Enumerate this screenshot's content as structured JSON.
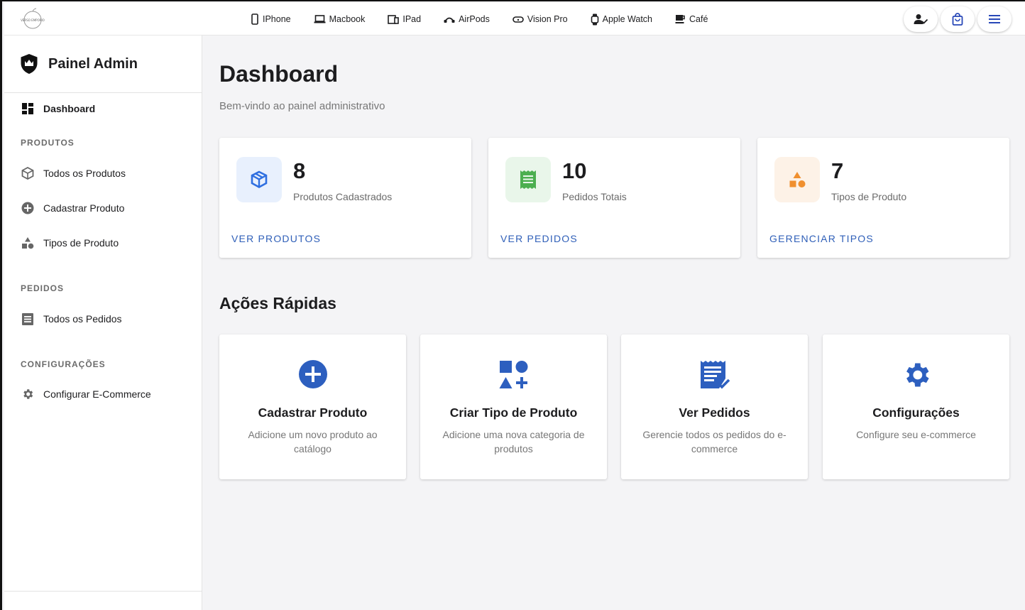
{
  "brand": {
    "logo_text": "VERSO EMPORIO"
  },
  "nav": {
    "items": [
      {
        "label": "IPhone",
        "icon": "phone-icon"
      },
      {
        "label": "Macbook",
        "icon": "laptop-icon"
      },
      {
        "label": "IPad",
        "icon": "tablet-icon"
      },
      {
        "label": "AirPods",
        "icon": "headphones-icon"
      },
      {
        "label": "Vision Pro",
        "icon": "vr-headset-icon"
      },
      {
        "label": "Apple Watch",
        "icon": "watch-icon"
      },
      {
        "label": "Café",
        "icon": "coffee-icon"
      }
    ],
    "actions": [
      "user-check-icon",
      "shopping-bag-icon",
      "menu-icon"
    ]
  },
  "sidebar": {
    "title": "Painel Admin",
    "dashboard_label": "Dashboard",
    "sections": {
      "produtos": "PRODUTOS",
      "pedidos": "PEDIDOS",
      "config": "CONFIGURAÇÕES"
    },
    "items": {
      "todos_produtos": "Todos os Produtos",
      "cadastrar_produto": "Cadastrar Produto",
      "tipos_produto": "Tipos de Produto",
      "todos_pedidos": "Todos os Pedidos",
      "configurar": "Configurar E-Commerce"
    }
  },
  "main": {
    "title": "Dashboard",
    "subtitle": "Bem-vindo ao painel administrativo",
    "stats": [
      {
        "value": "8",
        "label": "Produtos Cadastrados",
        "link": "VER PRODUTOS",
        "color": "#2f6fe0"
      },
      {
        "value": "10",
        "label": "Pedidos Totais",
        "link": "VER PEDIDOS",
        "color": "#4caf50"
      },
      {
        "value": "7",
        "label": "Tipos de Produto",
        "link": "GERENCIAR TIPOS",
        "color": "#f0902f"
      }
    ],
    "quick_title": "Ações Rápidas",
    "actions": [
      {
        "title": "Cadastrar Produto",
        "desc": "Adicione um novo produto ao catálogo"
      },
      {
        "title": "Criar Tipo de Produto",
        "desc": "Adicione uma nova categoria de produtos"
      },
      {
        "title": "Ver Pedidos",
        "desc": "Gerencie todos os pedidos do e-commerce"
      },
      {
        "title": "Configurações",
        "desc": "Configure seu e-commerce"
      }
    ]
  },
  "colors": {
    "accent": "#2f5fb8",
    "icon_blue": "#2d5fbf"
  }
}
